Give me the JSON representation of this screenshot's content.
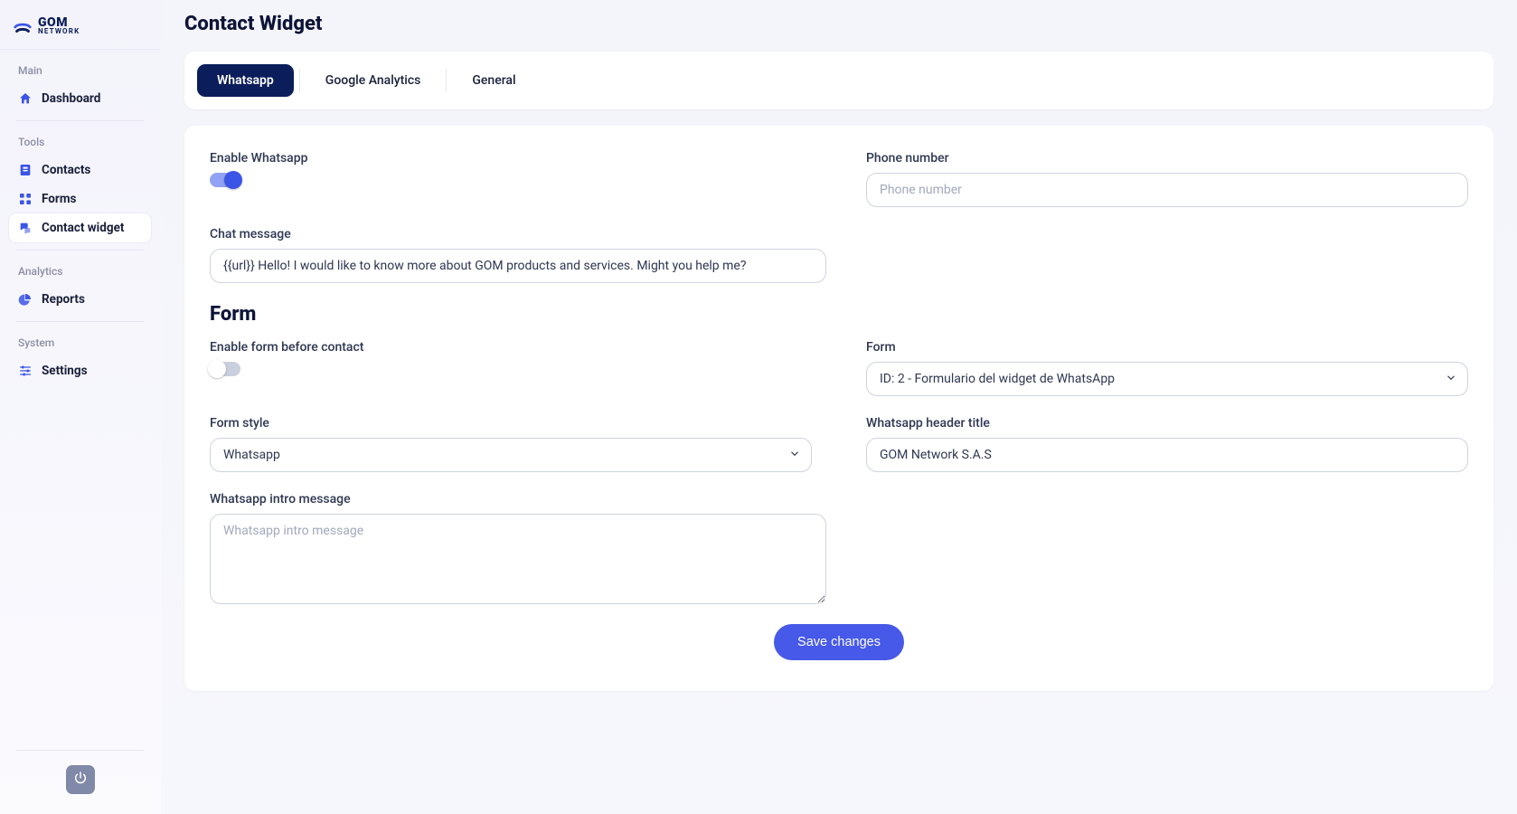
{
  "brand": {
    "line1": "GOM",
    "line2": "NETWORK"
  },
  "sidebar": {
    "sections": [
      {
        "heading": "Main",
        "items": [
          {
            "id": "dashboard",
            "label": "Dashboard",
            "icon": "home-icon"
          }
        ]
      },
      {
        "heading": "Tools",
        "items": [
          {
            "id": "contacts",
            "label": "Contacts",
            "icon": "contacts-icon"
          },
          {
            "id": "forms",
            "label": "Forms",
            "icon": "grid-icon"
          },
          {
            "id": "contact-widget",
            "label": "Contact widget",
            "icon": "chat-bubbles-icon",
            "active": true
          }
        ]
      },
      {
        "heading": "Analytics",
        "items": [
          {
            "id": "reports",
            "label": "Reports",
            "icon": "pie-icon"
          }
        ]
      },
      {
        "heading": "System",
        "items": [
          {
            "id": "settings",
            "label": "Settings",
            "icon": "sliders-icon"
          }
        ]
      }
    ]
  },
  "page": {
    "title": "Contact Widget"
  },
  "tabs": [
    {
      "id": "whatsapp",
      "label": "Whatsapp",
      "active": true
    },
    {
      "id": "ga",
      "label": "Google Analytics"
    },
    {
      "id": "general",
      "label": "General"
    }
  ],
  "whatsapp": {
    "enable_label": "Enable Whatsapp",
    "enabled": true,
    "phone_label": "Phone number",
    "phone_value": "",
    "phone_placeholder": "Phone number",
    "chat_label": "Chat message",
    "chat_value": "{{url}} Hello! I would like to know more about GOM products and services. Might you help me?"
  },
  "form_section": {
    "title": "Form",
    "enable_label": "Enable form before contact",
    "enabled": false,
    "form_label": "Form",
    "form_selected": "ID: 2 - Formulario del widget de WhatsApp",
    "style_label": "Form style",
    "style_selected": "Whatsapp",
    "header_label": "Whatsapp header title",
    "header_value": "GOM Network S.A.S",
    "intro_label": "Whatsapp intro message",
    "intro_value": "",
    "intro_placeholder": "Whatsapp intro message"
  },
  "actions": {
    "save": "Save changes"
  }
}
